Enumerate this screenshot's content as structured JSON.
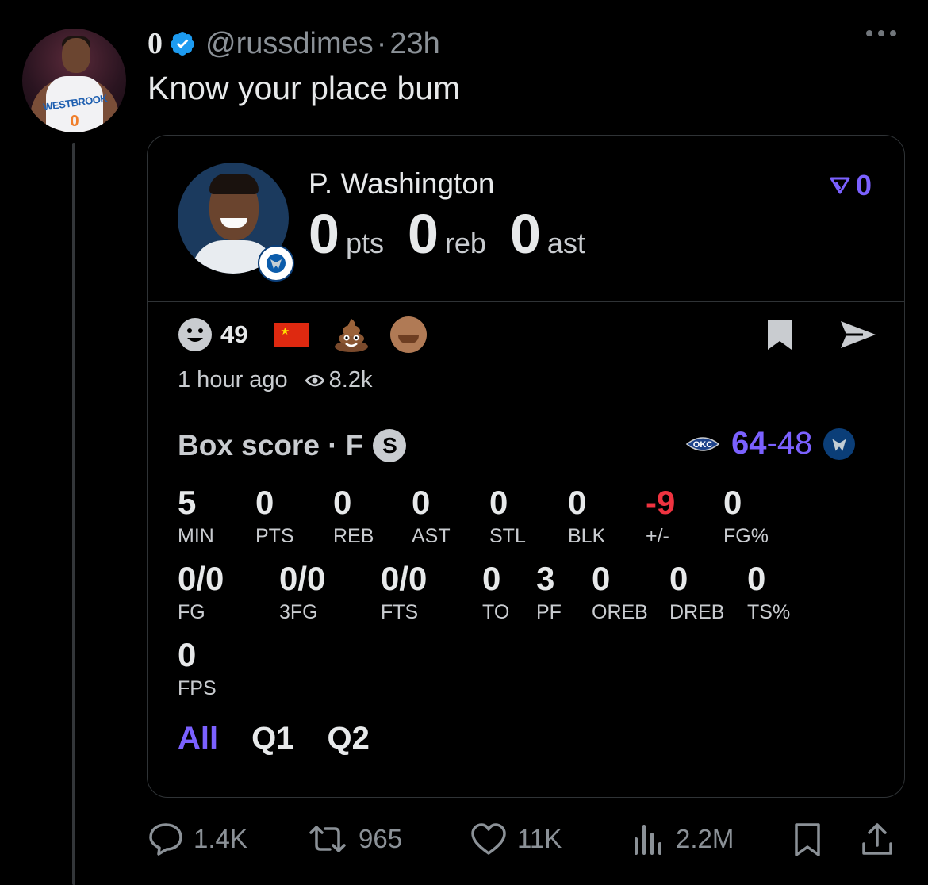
{
  "tweet": {
    "display_name": "0",
    "handle": "@russdimes",
    "separator": "·",
    "time": "23h",
    "text": "Know your place bum",
    "avatar_jersey_text": "WESTBROOK",
    "avatar_jersey_number": "0"
  },
  "card": {
    "player_name": "P. Washington",
    "pts": "0",
    "pts_label": "pts",
    "reb": "0",
    "reb_label": "reb",
    "ast": "0",
    "ast_label": "ast",
    "vote_count": "0",
    "reaction_count": "49",
    "flag_star": "★",
    "posted": "1 hour ago",
    "views": "8.2k",
    "box_title": "Box score · F",
    "status_badge": "S",
    "okc_logo_text": "OKC",
    "score_home": "64",
    "score_dash": "-",
    "score_away": "48",
    "stats_row1": [
      {
        "value": "5",
        "label": "MIN"
      },
      {
        "value": "0",
        "label": "PTS"
      },
      {
        "value": "0",
        "label": "REB"
      },
      {
        "value": "0",
        "label": "AST"
      },
      {
        "value": "0",
        "label": "STL"
      },
      {
        "value": "0",
        "label": "BLK"
      },
      {
        "value": "-9",
        "label": "+/-"
      },
      {
        "value": "0",
        "label": "FG%"
      }
    ],
    "stats_row2": [
      {
        "value": "0/0",
        "label": "FG"
      },
      {
        "value": "0/0",
        "label": "3FG"
      },
      {
        "value": "0/0",
        "label": "FTS"
      },
      {
        "value": "0",
        "label": "TO"
      },
      {
        "value": "3",
        "label": "PF"
      },
      {
        "value": "0",
        "label": "OREB"
      },
      {
        "value": "0",
        "label": "DREB"
      },
      {
        "value": "0",
        "label": "TS%"
      }
    ],
    "stats_row3": [
      {
        "value": "0",
        "label": "FPS"
      }
    ],
    "quarter_tabs": [
      "All",
      "Q1",
      "Q2"
    ],
    "accent": "#7b61ff",
    "negative": "#ef3340"
  },
  "actions": {
    "replies": "1.4K",
    "reposts": "965",
    "likes": "11K",
    "views": "2.2M"
  },
  "icons": [
    "verified-icon",
    "more-icon",
    "smiley-icon",
    "china-flag-icon",
    "poop-icon",
    "laughing-man-icon",
    "bookmark-icon",
    "send-icon",
    "eye-icon",
    "vote-arrow-icon",
    "reply-icon",
    "repost-icon",
    "like-icon",
    "views-icon",
    "share-icon"
  ]
}
